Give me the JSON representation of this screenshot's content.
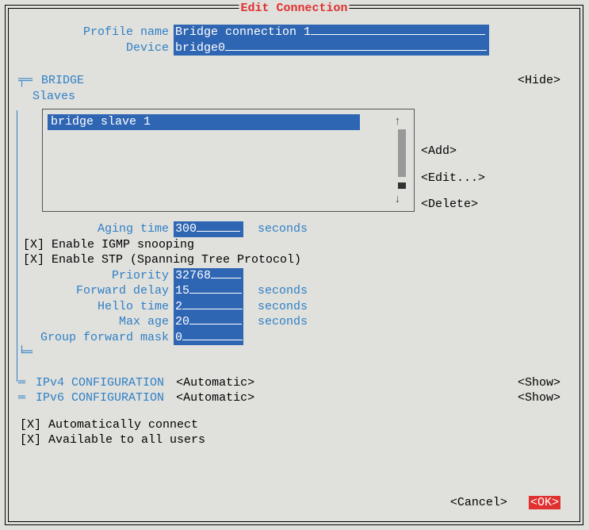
{
  "title": "Edit Connection",
  "profile": {
    "name_label": "Profile name",
    "name_value": "Bridge connection 1",
    "device_label": "Device",
    "device_value": "bridge0"
  },
  "bridge": {
    "section_label": "BRIDGE",
    "hide_label": "<Hide>",
    "slaves_label": "Slaves",
    "slave_item": "bridge slave 1",
    "add": "<Add>",
    "edit": "<Edit...>",
    "delete": "<Delete>",
    "aging_label": "Aging time",
    "aging_value": "300",
    "seconds": "seconds",
    "igmp_label": "[X] Enable IGMP snooping",
    "stp_label": "[X] Enable STP (Spanning Tree Protocol)",
    "priority_label": "Priority",
    "priority_value": "32768",
    "fwd_label": "Forward delay",
    "fwd_value": "15",
    "hello_label": "Hello time",
    "hello_value": "2",
    "maxage_label": "Max age",
    "maxage_value": "20",
    "gfm_label": "Group forward mask",
    "gfm_value": "0"
  },
  "ipv4": {
    "label": "IPv4 CONFIGURATION",
    "value": "<Automatic>",
    "show": "<Show>"
  },
  "ipv6": {
    "label": "IPv6 CONFIGURATION",
    "value": "<Automatic>",
    "show": "<Show>"
  },
  "auto_connect": "[X] Automatically connect",
  "all_users": "[X] Available to all users",
  "cancel": "<Cancel>",
  "ok": "<OK>"
}
